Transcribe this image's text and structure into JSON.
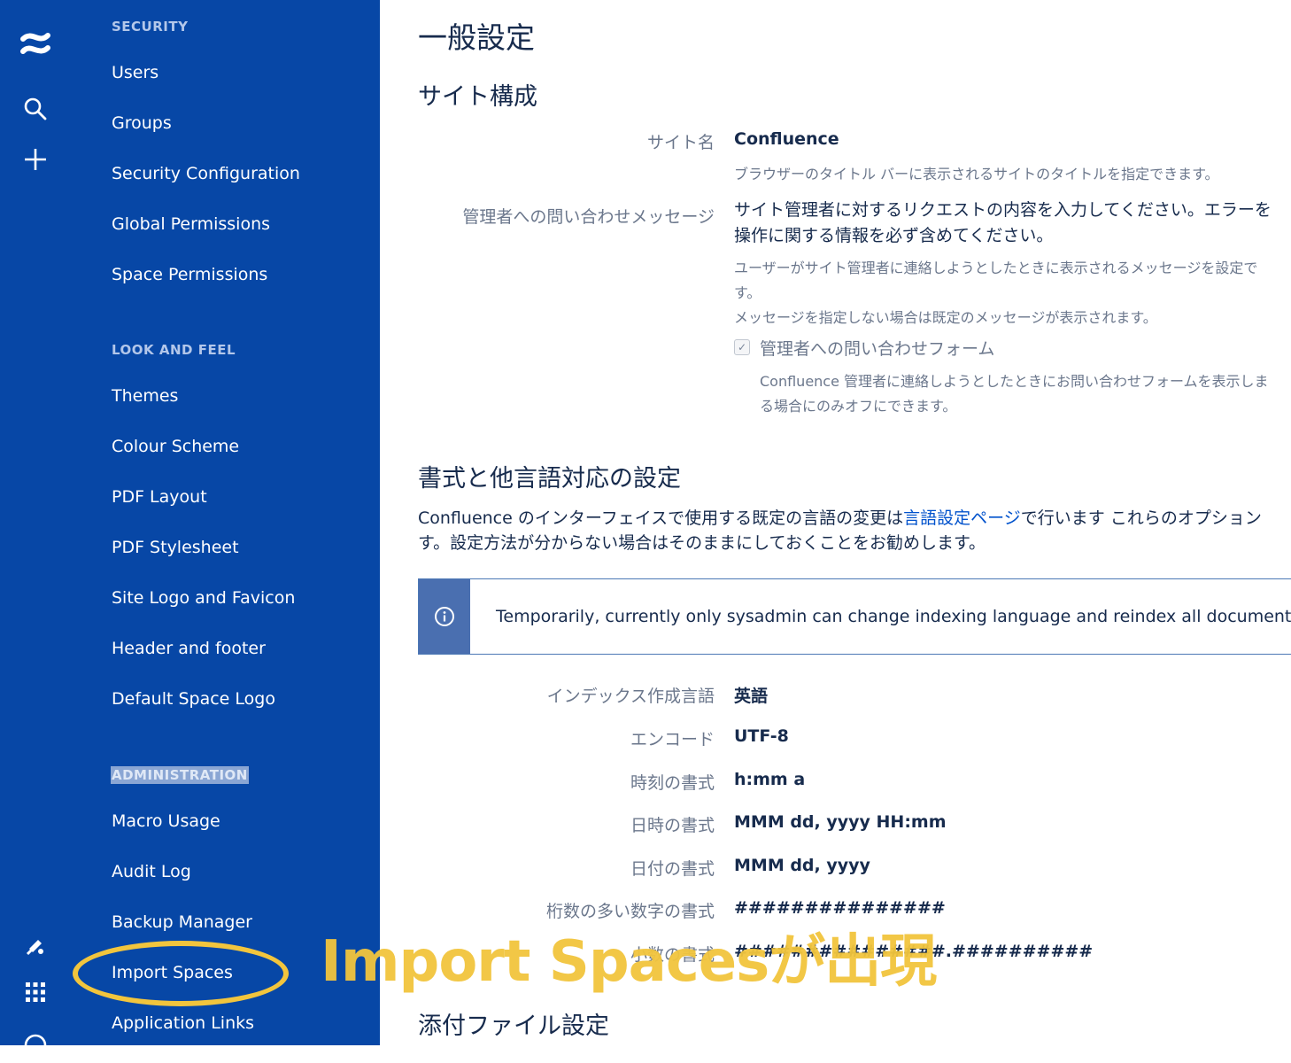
{
  "rail": {
    "logo_icon": "confluence-logo-icon",
    "search_icon": "search-icon",
    "create_icon": "plus-icon",
    "notifications_icon": "notification-icon",
    "apps_icon": "app-switcher-icon",
    "help_icon": "help-icon"
  },
  "sidebar": {
    "security": {
      "heading": "SECURITY",
      "items": [
        "Users",
        "Groups",
        "Security Configuration",
        "Global Permissions",
        "Space Permissions"
      ]
    },
    "look_and_feel": {
      "heading": "LOOK AND FEEL",
      "items": [
        "Themes",
        "Colour Scheme",
        "PDF Layout",
        "PDF Stylesheet",
        "Site Logo and Favicon",
        "Header and footer",
        "Default Space Logo"
      ]
    },
    "administration": {
      "heading": "ADMINISTRATION",
      "items": [
        "Macro Usage",
        "Audit Log",
        "Backup Manager",
        "Import Spaces",
        "Application Links"
      ]
    }
  },
  "main": {
    "page_title": "一般設定",
    "site_config": {
      "heading": "サイト構成",
      "site_name_label": "サイト名",
      "site_name_value": "Confluence",
      "site_name_desc": "ブラウザーのタイトル バーに表示されるサイトのタイトルを指定できます。",
      "contact_label": "管理者への問い合わせメッセージ",
      "contact_text_1": "サイト管理者に対するリクエストの内容を入力してください。エラーを",
      "contact_text_2": "操作に関する情報を必ず含めてください。",
      "contact_desc_1": "ユーザーがサイト管理者に連絡しようとしたときに表示されるメッセージを設定で",
      "contact_desc_2": "す。",
      "contact_desc_3": "メッセージを指定しない場合は既定のメッセージが表示されます。",
      "form_checkbox_label": "管理者への問い合わせフォーム",
      "form_checkbox_checked": true,
      "form_desc_1": "Confluence 管理者に連絡しようとしたときにお問い合わせフォームを表示しま",
      "form_desc_2": "る場合にのみオフにできます。"
    },
    "format": {
      "heading": "書式と他言語対応の設定",
      "intro_pre": "Confluence のインターフェイスで使用する既定の言語の変更は",
      "intro_link": "言語設定ページ",
      "intro_post": "で行います これらのオプション",
      "intro_line2": "す。設定方法が分からない場合はそのままにしておくことをお勧めします。",
      "info_icon": "info-icon",
      "info_message": "Temporarily, currently only sysadmin can change indexing language and reindex all documents. Co",
      "fields": [
        {
          "label": "インデックス作成言語",
          "value": "英語"
        },
        {
          "label": "エンコード",
          "value": "UTF-8"
        },
        {
          "label": "時刻の書式",
          "value": "h:mm a"
        },
        {
          "label": "日時の書式",
          "value": "MMM dd, yyyy HH:mm"
        },
        {
          "label": "日付の書式",
          "value": "MMM dd, yyyy"
        },
        {
          "label": "桁数の多い数字の書式",
          "value": "###############"
        },
        {
          "label": "小数の書式",
          "value": "###############.##########"
        }
      ]
    },
    "attachments": {
      "heading": "添付ファイル設定"
    }
  },
  "annotation": {
    "text": "Import Spacesが出現",
    "color": "#f2c53d"
  },
  "colors": {
    "sidebar_bg": "#0747a6",
    "link": "#0052cc",
    "info_bar": "#4a6fb0"
  }
}
